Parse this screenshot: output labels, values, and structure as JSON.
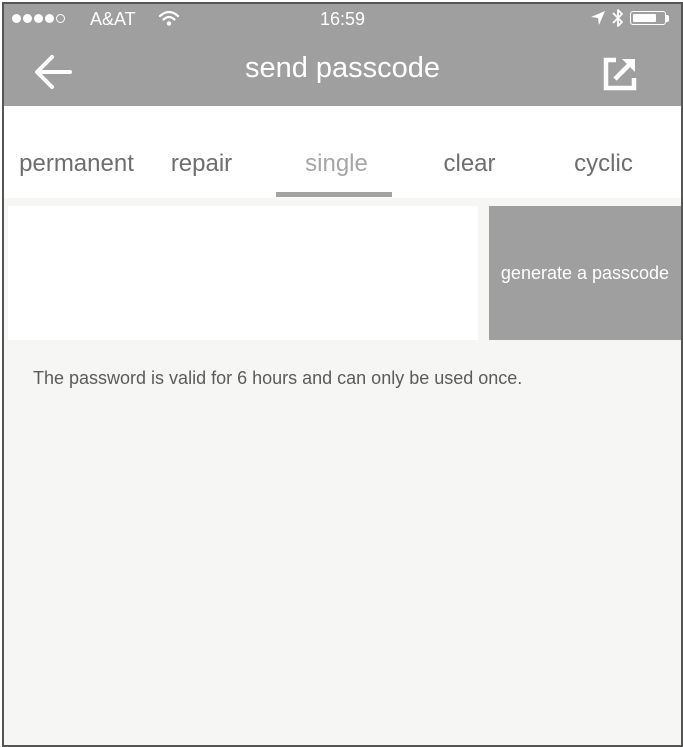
{
  "status_bar": {
    "carrier": "A&AT",
    "time": "16:59",
    "signal_dots_filled": 4,
    "signal_dots_total": 5,
    "battery_level": 0.8,
    "icons": [
      "wifi-icon",
      "location-arrow-icon",
      "bluetooth-icon",
      "battery-icon"
    ]
  },
  "header": {
    "title": "send passcode",
    "back_icon": "arrow-left-icon",
    "share_icon": "share-external-icon"
  },
  "tabs": [
    {
      "label": "permanent",
      "active": false
    },
    {
      "label": "repair",
      "active": false
    },
    {
      "label": "single",
      "active": true
    },
    {
      "label": "clear",
      "active": false
    },
    {
      "label": "cyclic",
      "active": false
    }
  ],
  "passcode": {
    "value": "",
    "placeholder": "",
    "generate_label": "generate a passcode"
  },
  "hint": "The password is valid for 6 hours and can only be used once.",
  "colors": {
    "header_bg": "#9e9f9e",
    "page_bg": "#f6f6f4",
    "tab_active": "#a6a6a6",
    "tab_inactive": "#6e6e6e",
    "button_bg": "#9e9f9e"
  }
}
